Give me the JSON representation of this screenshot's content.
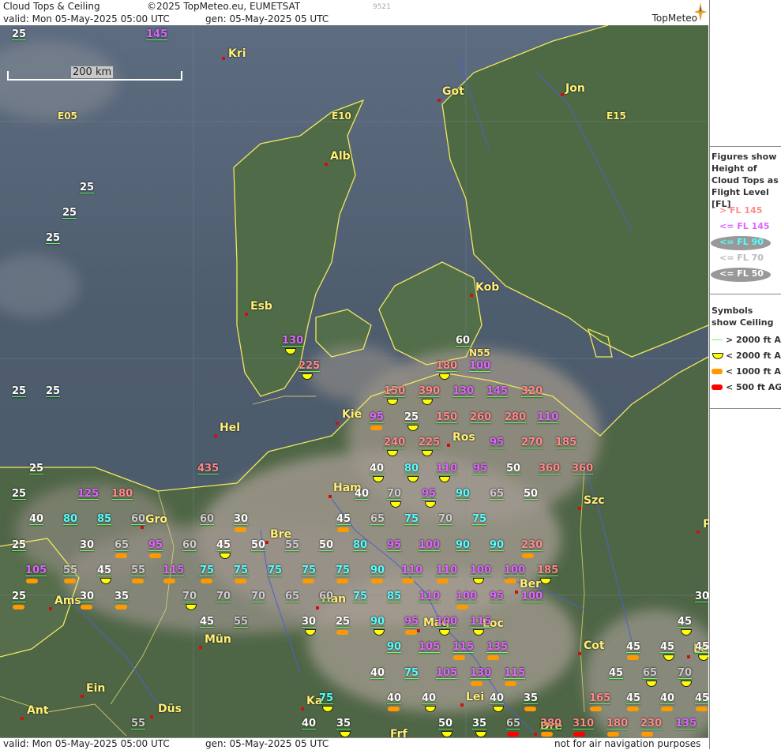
{
  "header": {
    "title": "Cloud Tops & Ceiling",
    "copyright": "©2025 TopMeteo.eu, EUMETSAT",
    "code": "9521",
    "valid": "valid:  Mon  05-May-2025  05:00 UTC",
    "gen": "gen: 05-May-2025 05 UTC",
    "logo": "TopMeteo"
  },
  "footer": {
    "valid": "valid:  Mon  05-May-2025  05:00 UTC",
    "gen": "gen: 05-May-2025 05 UTC",
    "disclaimer": "not for air navigation purposes"
  },
  "scale": {
    "label": "200 km"
  },
  "legend": {
    "figures_heading": "Figures show Height of Cloud Tops as Flight Level  [FL]",
    "figures": [
      {
        "label": "> FL 145",
        "color": "#ff8a8a",
        "oval": false
      },
      {
        "label": "<= FL 145",
        "color": "#dd66ff",
        "oval": false
      },
      {
        "label": "<= FL 90",
        "color": "#55ffff",
        "oval": true
      },
      {
        "label": "<= FL 70",
        "color": "#bbbbbb",
        "oval": false
      },
      {
        "label": "<= FL 50",
        "color": "#ffffff",
        "oval": true
      }
    ],
    "symbols_heading": "Symbols show Ceiling",
    "symbols": [
      {
        "label": "> 2000 ft AGL",
        "symbol": "line",
        "color": "#66ff66"
      },
      {
        "label": "< 2000 ft AGL",
        "symbol": "half-circle",
        "color": "#ffff00"
      },
      {
        "label": "< 1000 ft AGL",
        "symbol": "pill",
        "color": "#ff9900"
      },
      {
        "label": "< 500 ft AGL",
        "symbol": "pill",
        "color": "#ff0000"
      }
    ]
  },
  "colors": {
    "white": "#ffffff",
    "cyan": "#55ffff",
    "magenta": "#dd66ff",
    "pink": "#ff8a8a",
    "grey": "#cccccc",
    "yellow": "#ffef78"
  },
  "cities": [
    "Kri",
    "Got",
    "Jon",
    "Alb",
    "Kob",
    "Esb",
    "Kie",
    "Ros",
    "Hel",
    "Ham",
    "Szc",
    "Gro",
    "Bre",
    "Ams",
    "Han",
    "Ber",
    "Mag",
    "Loc",
    "Mün",
    "Cot",
    "Ein",
    "Ka",
    "Lei",
    "Ant",
    "Düs",
    "Le",
    "Frf",
    "Dre",
    "P"
  ],
  "roads": [
    "E05",
    "E10",
    "E15",
    "N55"
  ],
  "labels": [
    {
      "v": "25",
      "c": "white"
    },
    {
      "v": "145",
      "c": "magenta"
    },
    {
      "v": "25",
      "c": "white"
    },
    {
      "v": "25",
      "c": "white"
    },
    {
      "v": "25",
      "c": "white"
    },
    {
      "v": "130",
      "c": "magenta"
    },
    {
      "v": "225",
      "c": "pink"
    },
    {
      "v": "60",
      "c": "white"
    },
    {
      "v": "180",
      "c": "pink"
    },
    {
      "v": "100",
      "c": "magenta"
    },
    {
      "v": "25",
      "c": "white"
    },
    {
      "v": "25",
      "c": "white"
    },
    {
      "v": "150",
      "c": "pink"
    },
    {
      "v": "390",
      "c": "pink"
    },
    {
      "v": "130",
      "c": "magenta"
    },
    {
      "v": "145",
      "c": "magenta"
    },
    {
      "v": "320",
      "c": "pink"
    },
    {
      "v": "95",
      "c": "magenta"
    },
    {
      "v": "25",
      "c": "white"
    },
    {
      "v": "150",
      "c": "pink"
    },
    {
      "v": "260",
      "c": "pink"
    },
    {
      "v": "280",
      "c": "pink"
    },
    {
      "v": "110",
      "c": "magenta"
    },
    {
      "v": "240",
      "c": "pink"
    },
    {
      "v": "225",
      "c": "pink"
    },
    {
      "v": "95",
      "c": "magenta"
    },
    {
      "v": "270",
      "c": "pink"
    },
    {
      "v": "185",
      "c": "pink"
    },
    {
      "v": "25",
      "c": "white"
    },
    {
      "v": "435",
      "c": "pink"
    },
    {
      "v": "40",
      "c": "white"
    },
    {
      "v": "80",
      "c": "cyan"
    },
    {
      "v": "110",
      "c": "magenta"
    },
    {
      "v": "95",
      "c": "magenta"
    },
    {
      "v": "50",
      "c": "white"
    },
    {
      "v": "360",
      "c": "pink"
    },
    {
      "v": "360",
      "c": "pink"
    },
    {
      "v": "25",
      "c": "white"
    },
    {
      "v": "125",
      "c": "magenta"
    },
    {
      "v": "180",
      "c": "pink"
    },
    {
      "v": "40",
      "c": "white"
    },
    {
      "v": "70",
      "c": "grey"
    },
    {
      "v": "95",
      "c": "magenta"
    },
    {
      "v": "90",
      "c": "cyan"
    },
    {
      "v": "65",
      "c": "grey"
    },
    {
      "v": "50",
      "c": "white"
    },
    {
      "v": "40",
      "c": "white"
    },
    {
      "v": "80",
      "c": "cyan"
    },
    {
      "v": "85",
      "c": "cyan"
    },
    {
      "v": "60",
      "c": "grey"
    },
    {
      "v": "60",
      "c": "grey"
    },
    {
      "v": "30",
      "c": "white"
    },
    {
      "v": "45",
      "c": "white"
    },
    {
      "v": "65",
      "c": "grey"
    },
    {
      "v": "75",
      "c": "cyan"
    },
    {
      "v": "70",
      "c": "grey"
    },
    {
      "v": "75",
      "c": "cyan"
    },
    {
      "v": "25",
      "c": "white"
    },
    {
      "v": "30",
      "c": "white"
    },
    {
      "v": "65",
      "c": "grey"
    },
    {
      "v": "95",
      "c": "magenta"
    },
    {
      "v": "60",
      "c": "grey"
    },
    {
      "v": "45",
      "c": "white"
    },
    {
      "v": "50",
      "c": "white"
    },
    {
      "v": "55",
      "c": "grey"
    },
    {
      "v": "50",
      "c": "white"
    },
    {
      "v": "80",
      "c": "cyan"
    },
    {
      "v": "95",
      "c": "magenta"
    },
    {
      "v": "100",
      "c": "magenta"
    },
    {
      "v": "90",
      "c": "cyan"
    },
    {
      "v": "90",
      "c": "cyan"
    },
    {
      "v": "230",
      "c": "pink"
    },
    {
      "v": "105",
      "c": "magenta"
    },
    {
      "v": "55",
      "c": "grey"
    },
    {
      "v": "45",
      "c": "white"
    },
    {
      "v": "55",
      "c": "grey"
    },
    {
      "v": "115",
      "c": "magenta"
    },
    {
      "v": "75",
      "c": "cyan"
    },
    {
      "v": "75",
      "c": "cyan"
    },
    {
      "v": "75",
      "c": "cyan"
    },
    {
      "v": "75",
      "c": "cyan"
    },
    {
      "v": "75",
      "c": "cyan"
    },
    {
      "v": "90",
      "c": "cyan"
    },
    {
      "v": "110",
      "c": "magenta"
    },
    {
      "v": "110",
      "c": "magenta"
    },
    {
      "v": "100",
      "c": "magenta"
    },
    {
      "v": "100",
      "c": "magenta"
    },
    {
      "v": "185",
      "c": "pink"
    },
    {
      "v": "25",
      "c": "white"
    },
    {
      "v": "30",
      "c": "white"
    },
    {
      "v": "35",
      "c": "white"
    },
    {
      "v": "70",
      "c": "grey"
    },
    {
      "v": "70",
      "c": "grey"
    },
    {
      "v": "70",
      "c": "grey"
    },
    {
      "v": "65",
      "c": "grey"
    },
    {
      "v": "60",
      "c": "grey"
    },
    {
      "v": "75",
      "c": "cyan"
    },
    {
      "v": "85",
      "c": "cyan"
    },
    {
      "v": "110",
      "c": "magenta"
    },
    {
      "v": "100",
      "c": "magenta"
    },
    {
      "v": "95",
      "c": "magenta"
    },
    {
      "v": "100",
      "c": "magenta"
    },
    {
      "v": "30",
      "c": "white"
    },
    {
      "v": "45",
      "c": "white"
    },
    {
      "v": "55",
      "c": "grey"
    },
    {
      "v": "30",
      "c": "white"
    },
    {
      "v": "25",
      "c": "white"
    },
    {
      "v": "90",
      "c": "cyan"
    },
    {
      "v": "95",
      "c": "magenta"
    },
    {
      "v": "100",
      "c": "magenta"
    },
    {
      "v": "115",
      "c": "magenta"
    },
    {
      "v": "45",
      "c": "white"
    },
    {
      "v": "90",
      "c": "cyan"
    },
    {
      "v": "105",
      "c": "magenta"
    },
    {
      "v": "115",
      "c": "magenta"
    },
    {
      "v": "135",
      "c": "magenta"
    },
    {
      "v": "45",
      "c": "white"
    },
    {
      "v": "45",
      "c": "white"
    },
    {
      "v": "45",
      "c": "white"
    },
    {
      "v": "40",
      "c": "white"
    },
    {
      "v": "75",
      "c": "cyan"
    },
    {
      "v": "105",
      "c": "magenta"
    },
    {
      "v": "130",
      "c": "magenta"
    },
    {
      "v": "115",
      "c": "magenta"
    },
    {
      "v": "45",
      "c": "white"
    },
    {
      "v": "65",
      "c": "grey"
    },
    {
      "v": "70",
      "c": "grey"
    },
    {
      "v": "75",
      "c": "cyan"
    },
    {
      "v": "40",
      "c": "white"
    },
    {
      "v": "40",
      "c": "white"
    },
    {
      "v": "40",
      "c": "white"
    },
    {
      "v": "35",
      "c": "white"
    },
    {
      "v": "165",
      "c": "pink"
    },
    {
      "v": "45",
      "c": "white"
    },
    {
      "v": "40",
      "c": "white"
    },
    {
      "v": "45",
      "c": "white"
    },
    {
      "v": "55",
      "c": "grey"
    },
    {
      "v": "40",
      "c": "white"
    },
    {
      "v": "35",
      "c": "white"
    },
    {
      "v": "50",
      "c": "white"
    },
    {
      "v": "35",
      "c": "white"
    },
    {
      "v": "65",
      "c": "grey"
    },
    {
      "v": "380",
      "c": "pink"
    },
    {
      "v": "310",
      "c": "pink"
    },
    {
      "v": "180",
      "c": "pink"
    },
    {
      "v": "230",
      "c": "pink"
    },
    {
      "v": "135",
      "c": "magenta"
    }
  ]
}
